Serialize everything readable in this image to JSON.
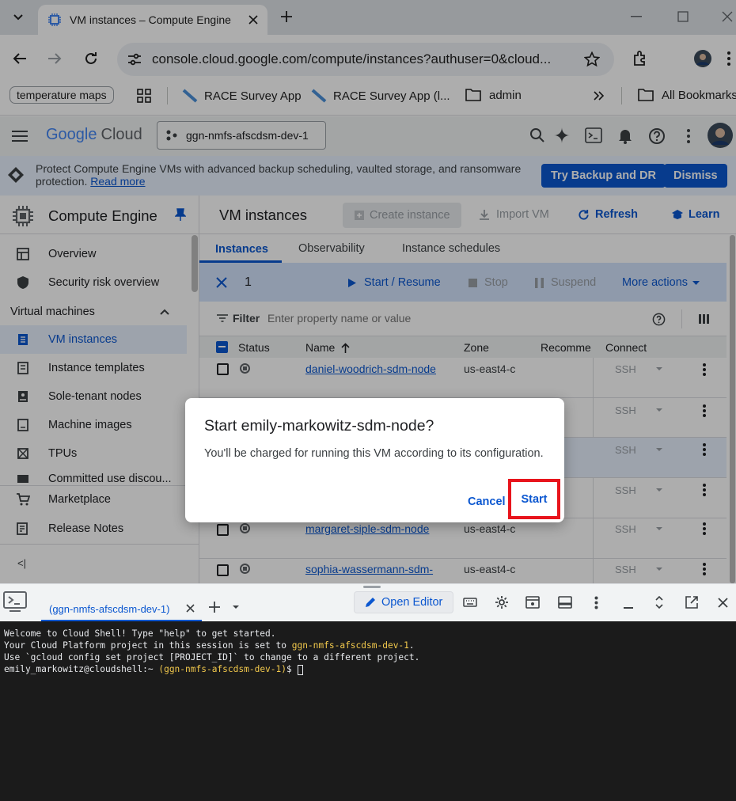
{
  "browser": {
    "tab_title": "VM instances – Compute Engine",
    "url": "console.cloud.google.com/compute/instances?authuser=0&cloud...",
    "bookmarks": [
      "temperature maps",
      "RACE Survey App",
      "RACE Survey App (l...",
      "admin",
      "All Bookmarks"
    ]
  },
  "gcp": {
    "logo_google": "Google",
    "logo_cloud": "Cloud",
    "project": "ggn-nmfs-afscdsm-dev-1"
  },
  "banner": {
    "text": "Protect Compute Engine VMs with advanced backup scheduling, vaulted storage, and ransomware protection.",
    "link": "Read more",
    "try_button": "Try Backup and DR",
    "dismiss_button": "Dismiss"
  },
  "sidebar": {
    "product": "Compute Engine",
    "items_top": [
      "Overview",
      "Security risk overview"
    ],
    "section": "Virtual machines",
    "items_vm": [
      "VM instances",
      "Instance templates",
      "Sole-tenant nodes",
      "Machine images",
      "TPUs",
      "Committed use discou..."
    ],
    "items_bottom": [
      "Marketplace",
      "Release Notes"
    ],
    "collapse": "<|"
  },
  "main": {
    "title": "VM instances",
    "create": "Create instance",
    "import": "Import VM",
    "refresh": "Refresh",
    "learn": "Learn",
    "tabs": [
      "Instances",
      "Observability",
      "Instance schedules"
    ],
    "selected_count": "1",
    "actions": [
      "Start / Resume",
      "Stop",
      "Suspend",
      "More actions"
    ],
    "filter_label": "Filter",
    "filter_placeholder": "Enter property name or value",
    "columns": [
      "Status",
      "Name",
      "Zone",
      "Recomme",
      "Connect"
    ],
    "rows": [
      {
        "name": "daniel-woodrich-sdm-node",
        "zone": "us-east4-c",
        "ssh": "SSH"
      },
      {
        "name": "",
        "zone": "",
        "ssh": "SSH"
      },
      {
        "name": "",
        "zone": "",
        "ssh": "SSH"
      },
      {
        "name": "",
        "zone": "",
        "ssh": "SSH"
      },
      {
        "name": "margaret-siple-sdm-node",
        "zone": "us-east4-c",
        "ssh": "SSH"
      },
      {
        "name": "sophia-wassermann-sdm-",
        "zone": "us-east4-c",
        "ssh": "SSH"
      }
    ]
  },
  "dialog": {
    "title": "Start emily-markowitz-sdm-node?",
    "body": "You'll be charged for running this VM according to its configuration.",
    "cancel": "Cancel",
    "start": "Start"
  },
  "shell": {
    "tab_label": "(ggn-nmfs-afscdsm-dev-1)",
    "open_editor": "Open Editor",
    "line1": "Welcome to Cloud Shell! Type \"help\" to get started.",
    "line2_a": "Your Cloud Platform project in this session is set to ",
    "line2_b": "ggn-nmfs-afscdsm-dev-1",
    "line2_c": ".",
    "line3": "Use `gcloud config set project [PROJECT_ID]` to change to a different project.",
    "prompt_user": "emily_markowitz@cloudshell:~",
    "prompt_proj": "(ggn-nmfs-afscdsm-dev-1)",
    "prompt_end": "$"
  },
  "colors": {
    "accent": "#0b57d0",
    "highlight_box": "#e8141c",
    "terminal_bg": "#1b1b1b",
    "terminal_yellow": "#f2c94c"
  }
}
